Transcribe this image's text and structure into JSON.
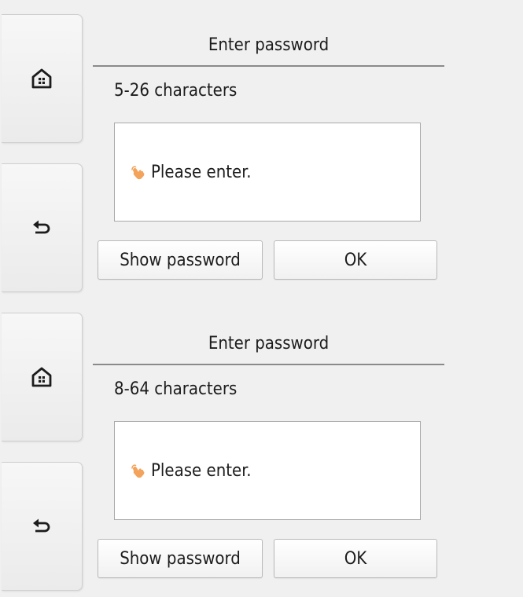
{
  "colors": {
    "background": "#f0f0f0",
    "entry_background": "#ffffff",
    "hint_icon": "#f3a35b",
    "rule": "#8a8a8a"
  },
  "panels": [
    {
      "home_icon": "home-icon",
      "back_icon": "back-arrow-icon",
      "title": "Enter password",
      "char_range": "5-26 characters",
      "entry_hint_icon": "tap-hand-icon",
      "entry_hint": "Please enter.",
      "show_password_label": "Show password",
      "ok_label": "OK"
    },
    {
      "home_icon": "home-icon",
      "back_icon": "back-arrow-icon",
      "title": "Enter password",
      "char_range": "8-64 characters",
      "entry_hint_icon": "tap-hand-icon",
      "entry_hint": "Please enter.",
      "show_password_label": "Show password",
      "ok_label": "OK"
    }
  ]
}
